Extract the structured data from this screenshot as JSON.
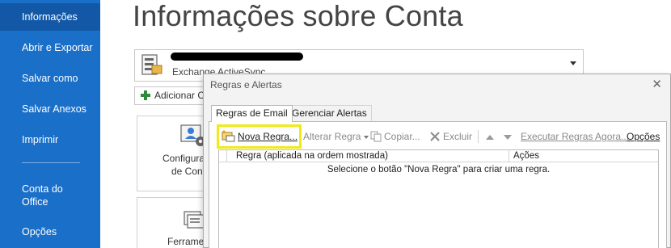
{
  "nav": {
    "items": [
      {
        "label": "Informações"
      },
      {
        "label": "Abrir e Exportar"
      },
      {
        "label": "Salvar como"
      },
      {
        "label": "Salvar Anexos"
      },
      {
        "label": "Imprimir"
      },
      {
        "label": "Conta do Office"
      },
      {
        "label": "Opções"
      }
    ],
    "bg_color": "#1a6fc9",
    "active_color": "#1258a7"
  },
  "page": {
    "title": "Informações sobre Conta"
  },
  "account": {
    "type": "Exchange ActiveSync"
  },
  "add_account": {
    "label": "Adicionar Conta"
  },
  "tiles": {
    "account_settings": {
      "line1": "Configurações",
      "line2": "de Conta"
    },
    "tools": {
      "line1": "Ferramentas"
    }
  },
  "dialog": {
    "title": "Regras e Alertas",
    "tabs": [
      {
        "label": "Regras de Email"
      },
      {
        "label": "Gerenciar Alertas"
      }
    ],
    "toolbar": {
      "new_rule": "Nova Regra...",
      "change_rule": "Alterar Regra",
      "copy": "Copiar...",
      "delete": "Excluir",
      "run_rules": "Executar Regras Agora...",
      "options": "Opções"
    },
    "table": {
      "col_rule": "Regra (aplicada na ordem mostrada)",
      "col_actions": "Ações",
      "empty_message": "Selecione o botão \"Nova Regra\" para criar uma regra."
    },
    "highlight_color": "#f0ea1a"
  }
}
